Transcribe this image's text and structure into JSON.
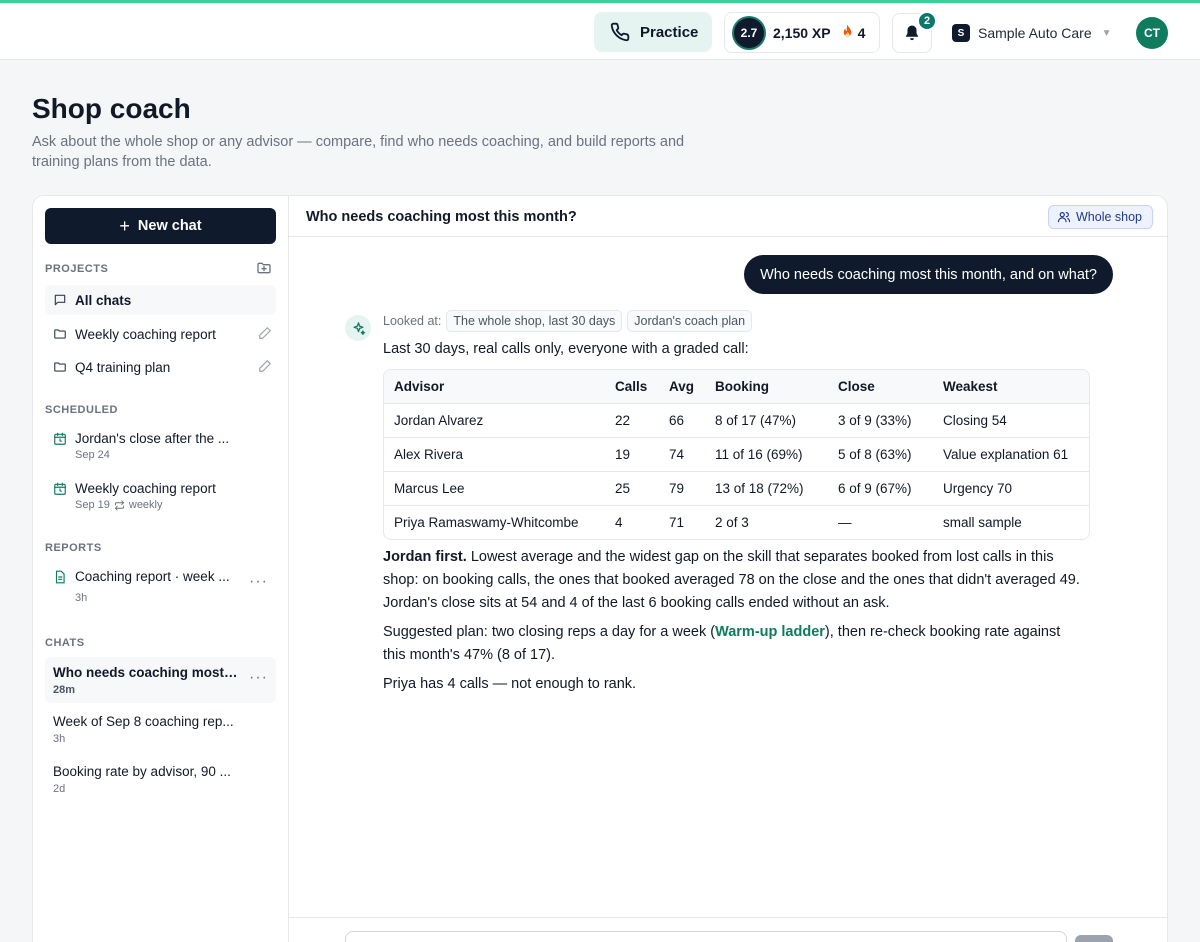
{
  "topbar": {
    "practice_label": "Practice",
    "level": "2.7",
    "xp": "2,150 XP",
    "streak": "4",
    "notifications": "2",
    "shop_initial": "S",
    "shop_name": "Sample Auto Care",
    "avatar_initials": "CT"
  },
  "page": {
    "title": "Shop coach",
    "subtitle": "Ask about the whole shop or any advisor — compare, find who needs coaching, and build reports and training plans from the data."
  },
  "sidebar": {
    "new_chat_label": "New chat",
    "projects_label": "PROJECTS",
    "projects": [
      {
        "label": "All chats"
      },
      {
        "label": "Weekly coaching report"
      },
      {
        "label": "Q4 training plan"
      }
    ],
    "scheduled_label": "SCHEDULED",
    "scheduled": [
      {
        "label": "Jordan's close after the ...",
        "meta": "Sep 24"
      },
      {
        "label": "Weekly coaching report",
        "meta": "Sep 19",
        "repeat": "weekly"
      }
    ],
    "reports_label": "REPORTS",
    "reports": [
      {
        "label": "Coaching report · week ...",
        "meta": "3h"
      }
    ],
    "chats_label": "CHATS",
    "chats": [
      {
        "label": "Who needs coaching most ...",
        "meta": "28m"
      },
      {
        "label": "Week of Sep 8 coaching rep...",
        "meta": "3h"
      },
      {
        "label": "Booking rate by advisor, 90 ...",
        "meta": "2d"
      }
    ]
  },
  "main": {
    "title": "Who needs coaching most this month?",
    "scope_label": "Whole shop",
    "user_message": "Who needs coaching most this month, and on what?",
    "looked_at_label": "Looked at:",
    "looked_at_chips": [
      "The whole shop, last 30 days",
      "Jordan's coach plan"
    ],
    "intro": "Last 30 days, real calls only, everyone with a graded call:",
    "table": {
      "headers": [
        "Advisor",
        "Calls",
        "Avg",
        "Booking",
        "Close",
        "Weakest"
      ],
      "rows": [
        [
          "Jordan Alvarez",
          "22",
          "66",
          "8 of 17 (47%)",
          "3 of 9 (33%)",
          "Closing 54"
        ],
        [
          "Alex Rivera",
          "19",
          "74",
          "11 of 16 (69%)",
          "5 of 8 (63%)",
          "Value explanation 61"
        ],
        [
          "Marcus Lee",
          "25",
          "79",
          "13 of 18 (72%)",
          "6 of 9 (67%)",
          "Urgency 70"
        ],
        [
          "Priya Ramaswamy-Whitcombe",
          "4",
          "71",
          "2 of 3",
          "—",
          "small sample"
        ]
      ]
    },
    "para1_bold": "Jordan first.",
    "para1_text": " Lowest average and the widest gap on the skill that separates booked from lost calls in this shop: on booking calls, the ones that booked averaged 78 on the close and the ones that didn't averaged 49. Jordan's close sits at 54 and 4 of the last 6 booking calls ended without an ask.",
    "para2_pre": "Suggested plan: two closing reps a day for a week (",
    "para2_link": "Warm-up ladder",
    "para2_post": "), then re-check booking rate against this month's 47% (8 of 17).",
    "para3": "Priya has 4 calls — not enough to rank."
  }
}
